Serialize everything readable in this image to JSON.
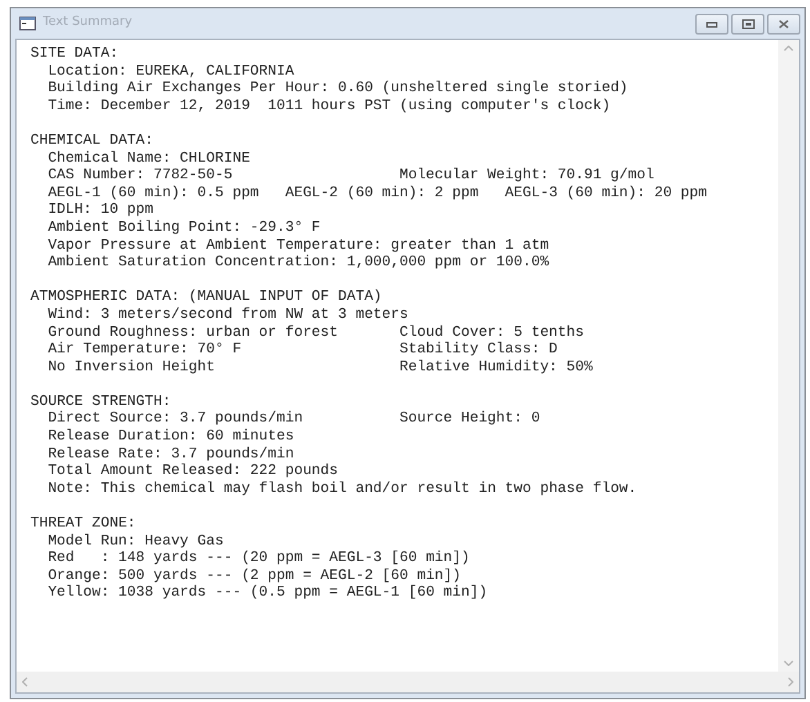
{
  "window": {
    "title": "Text Summary"
  },
  "sections": [
    {
      "heading": "SITE DATA:",
      "lines": [
        {
          "left": "Location: EUREKA, CALIFORNIA"
        },
        {
          "left": "Building Air Exchanges Per Hour: 0.60 (unsheltered single storied)"
        },
        {
          "left": "Time: December 12, 2019  1011 hours PST (using computer's clock)"
        }
      ]
    },
    {
      "heading": "CHEMICAL DATA:",
      "lines": [
        {
          "left": "Chemical Name: CHLORINE"
        },
        {
          "left": "CAS Number: 7782-50-5",
          "right": "Molecular Weight: 70.91 g/mol"
        },
        {
          "left": "AEGL-1 (60 min): 0.5 ppm   AEGL-2 (60 min): 2 ppm   AEGL-3 (60 min): 20 ppm"
        },
        {
          "left": "IDLH: 10 ppm"
        },
        {
          "left": "Ambient Boiling Point: -29.3° F"
        },
        {
          "left": "Vapor Pressure at Ambient Temperature: greater than 1 atm"
        },
        {
          "left": "Ambient Saturation Concentration: 1,000,000 ppm or 100.0%"
        }
      ]
    },
    {
      "heading": "ATMOSPHERIC DATA: (MANUAL INPUT OF DATA)",
      "lines": [
        {
          "left": "Wind: 3 meters/second from NW at 3 meters"
        },
        {
          "left": "Ground Roughness: urban or forest",
          "right": "Cloud Cover: 5 tenths"
        },
        {
          "left": "Air Temperature: 70° F",
          "right": "Stability Class: D"
        },
        {
          "left": "No Inversion Height",
          "right": "Relative Humidity: 50%"
        }
      ]
    },
    {
      "heading": "SOURCE STRENGTH:",
      "lines": [
        {
          "left": "Direct Source: 3.7 pounds/min",
          "right": "Source Height: 0"
        },
        {
          "left": "Release Duration: 60 minutes"
        },
        {
          "left": "Release Rate: 3.7 pounds/min"
        },
        {
          "left": "Total Amount Released: 222 pounds"
        },
        {
          "left": "Note: This chemical may flash boil and/or result in two phase flow."
        }
      ]
    },
    {
      "heading": "THREAT ZONE:",
      "lines": [
        {
          "left": "Model Run: Heavy Gas"
        },
        {
          "left": "Red   : 148 yards --- (20 ppm = AEGL-3 [60 min])"
        },
        {
          "left": "Orange: 500 yards --- (2 ppm = AEGL-2 [60 min])"
        },
        {
          "left": "Yellow: 1038 yards --- (0.5 ppm = AEGL-1 [60 min])"
        }
      ]
    }
  ]
}
